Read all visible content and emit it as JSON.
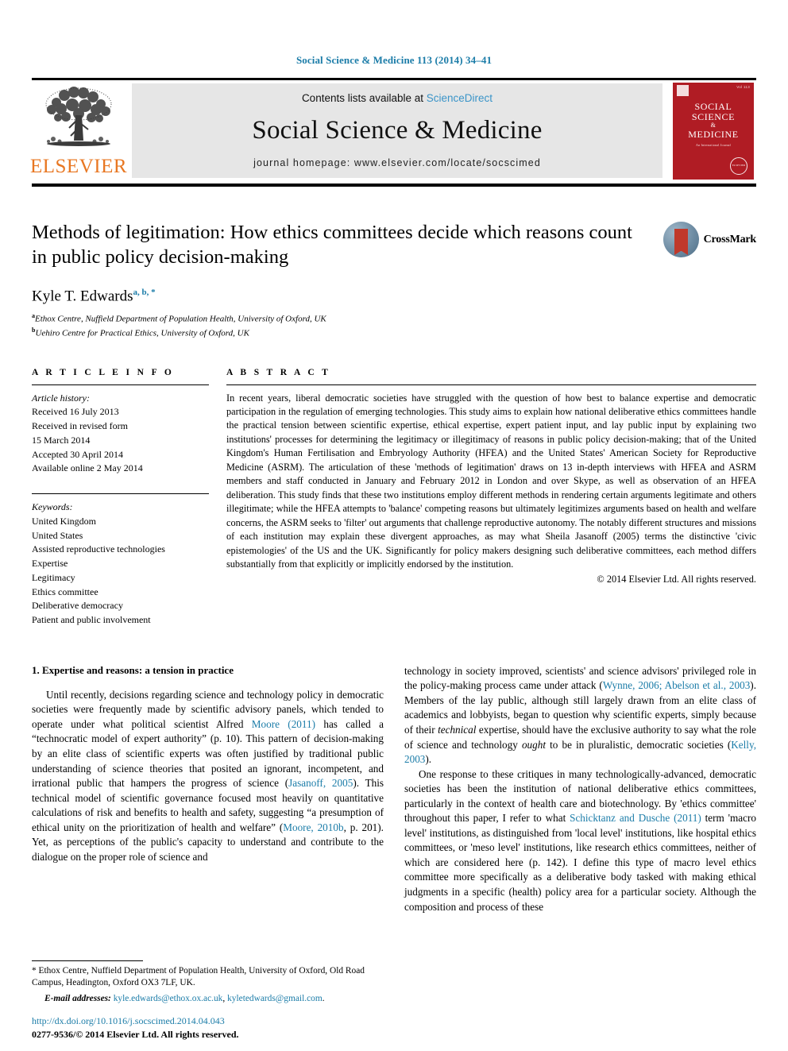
{
  "running_head": "Social Science & Medicine 113 (2014) 34–41",
  "banner": {
    "publisher_logo_text": "ELSEVIER",
    "contents_prefix": "Contents lists available at ",
    "contents_link": "ScienceDirect",
    "journal_title": "Social Science & Medicine",
    "homepage": "journal homepage: www.elsevier.com/locate/socscimed",
    "cover": {
      "title_line1": "SOCIAL",
      "title_line2": "SCIENCE",
      "amp": "&",
      "title_line3": "MEDICINE",
      "subtitle": "An International Journal",
      "issue": "Vol 113",
      "seal": "ELSEVIER"
    }
  },
  "article": {
    "title": "Methods of legitimation: How ethics committees decide which reasons count in public policy decision-making",
    "author": "Kyle T. Edwards",
    "author_marks": "a, b, *",
    "affiliations": [
      {
        "mark": "a",
        "text": "Ethox Centre, Nuffield Department of Population Health, University of Oxford, UK"
      },
      {
        "mark": "b",
        "text": "Uehiro Centre for Practical Ethics, University of Oxford, UK"
      }
    ],
    "crossmark_label": "CrossMark"
  },
  "info": {
    "heading": "A R T I C L E   I N F O",
    "history_label": "Article history:",
    "history": [
      "Received 16 July 2013",
      "Received in revised form",
      "15 March 2014",
      "Accepted 30 April 2014",
      "Available online 2 May 2014"
    ],
    "keywords_label": "Keywords:",
    "keywords": [
      "United Kingdom",
      "United States",
      "Assisted reproductive technologies",
      "Expertise",
      "Legitimacy",
      "Ethics committee",
      "Deliberative democracy",
      "Patient and public involvement"
    ]
  },
  "abstract": {
    "heading": "A B S T R A C T",
    "text": "In recent years, liberal democratic societies have struggled with the question of how best to balance expertise and democratic participation in the regulation of emerging technologies. This study aims to explain how national deliberative ethics committees handle the practical tension between scientific expertise, ethical expertise, expert patient input, and lay public input by explaining two institutions' processes for determining the legitimacy or illegitimacy of reasons in public policy decision-making; that of the United Kingdom's Human Fertilisation and Embryology Authority (HFEA) and the United States' American Society for Reproductive Medicine (ASRM). The articulation of these 'methods of legitimation' draws on 13 in-depth interviews with HFEA and ASRM members and staff conducted in January and February 2012 in London and over Skype, as well as observation of an HFEA deliberation. This study finds that these two institutions employ different methods in rendering certain arguments legitimate and others illegitimate; while the HFEA attempts to 'balance' competing reasons but ultimately legitimizes arguments based on health and welfare concerns, the ASRM seeks to 'filter' out arguments that challenge reproductive autonomy. The notably different structures and missions of each institution may explain these divergent approaches, as may what Sheila Jasanoff (2005) terms the distinctive 'civic epistemologies' of the US and the UK. Significantly for policy makers designing such deliberative committees, each method differs substantially from that explicitly or implicitly endorsed by the institution.",
    "copyright": "© 2014 Elsevier Ltd. All rights reserved."
  },
  "body": {
    "section_heading": "1. Expertise and reasons: a tension in practice",
    "left_paragraph_parts": {
      "p1_a": "Until recently, decisions regarding science and technology policy in democratic societies were frequently made by scientific advisory panels, which tended to operate under what political scientist Alfred ",
      "p1_link1": "Moore (2011)",
      "p1_b": " has called a “technocratic model of expert authority” (p. 10). This pattern of decision-making by an elite class of scientific experts was often justified by traditional public understanding of science theories that posited an ignorant, incompetent, and irrational public that hampers the progress of science (",
      "p1_link2": "Jasanoff, 2005",
      "p1_c": "). This technical model of scientific governance focused most heavily on quantitative calculations of risk and benefits to health and safety, suggesting “a presumption of ethical unity on the prioritization of health and welfare” (",
      "p1_link3": "Moore, 2010b",
      "p1_d": ", p. 201). Yet, as perceptions of the public's capacity to understand and contribute to the dialogue on the proper role of science and"
    },
    "right_paragraph_parts": {
      "p1_a": "technology in society improved, scientists' and science advisors' privileged role in the policy-making process came under attack (",
      "p1_link1": "Wynne, 2006; Abelson et al., 2003",
      "p1_b": "). Members of the lay public, although still largely drawn from an elite class of academics and lobbyists, began to question why scientific experts, simply because of their ",
      "p1_italic": "technical",
      "p1_c": " expertise, should have the exclusive authority to say what the role of science and technology ",
      "p1_italic2": "ought",
      "p1_d": " to be in pluralistic, democratic societies (",
      "p1_link2": "Kelly, 2003",
      "p1_e": ").",
      "p2_a": "One response to these critiques in many technologically-advanced, democratic societies has been the institution of national deliberative ethics committees, particularly in the context of health care and biotechnology. By 'ethics committee' throughout this paper, I refer to what ",
      "p2_link1": "Schicktanz and Dusche (2011)",
      "p2_b": " term 'macro level' institutions, as distinguished from 'local level' institutions, like hospital ethics committees, or 'meso level' institutions, like research ethics committees, neither of which are considered here (p. 142). I define this type of macro level ethics committee more specifically as a deliberative body tasked with making ethical judgments in a specific (health) policy area for a particular society. Although the composition and process of these"
    }
  },
  "footer": {
    "corresponding_mark": "*",
    "corresponding": " Ethox Centre, Nuffield Department of Population Health, University of Oxford, Old Road Campus, Headington, Oxford OX3 7LF, UK.",
    "email_label": "E-mail addresses:",
    "email1": "kyle.edwards@ethox.ox.ac.uk",
    "email_sep": ", ",
    "email2": "kyletedwards@gmail.com",
    "email_end": ".",
    "doi": "http://dx.doi.org/10.1016/j.socscimed.2014.04.043",
    "issn": "0277-9536/© 2014 Elsevier Ltd. All rights reserved."
  },
  "colors": {
    "link": "#1b7ca8",
    "sciencedirect": "#3a94c8",
    "elsevier_orange": "#E87722",
    "cover_red": "#b01c24",
    "banner_gray": "#e6e6e6"
  }
}
